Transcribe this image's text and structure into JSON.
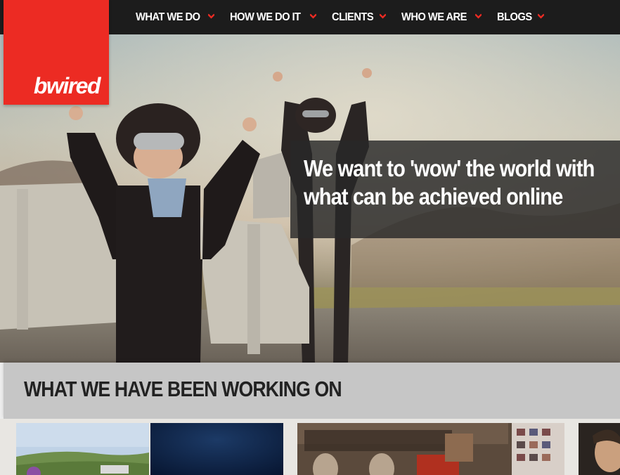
{
  "nav": {
    "items": [
      {
        "label": "WHAT WE DO"
      },
      {
        "label": "HOW WE DO IT"
      },
      {
        "label": "CLIENTS"
      },
      {
        "label": "WHO WE ARE"
      },
      {
        "label": "BLOGS"
      }
    ]
  },
  "logo": {
    "text": "bwired"
  },
  "hero": {
    "caption": "We want to 'wow' the world with what can be achieved online"
  },
  "work": {
    "title": "WHAT WE HAVE BEEN WORKING ON"
  },
  "colors": {
    "brand_red": "#ec2b23",
    "nav_bg": "#1c1c1c",
    "section_header_bg": "#c6c6c6"
  },
  "icons": {
    "nav_dropdown": "chevron-down-icon"
  }
}
